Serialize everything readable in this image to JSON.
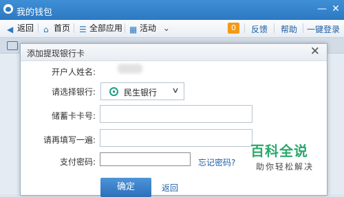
{
  "window": {
    "title": "我的钱包"
  },
  "toolbar": {
    "back": "返回",
    "home": "首页",
    "all_apps": "全部应用",
    "activity": "活动",
    "badge": "0",
    "feedback": "反馈",
    "help": "帮助",
    "login": "一键登录"
  },
  "dialog": {
    "title": "添加提现银行卡",
    "name_label": "开户人姓名:",
    "bank_label": "请选择银行:",
    "bank_selected": "民生银行",
    "card_label": "储蓄卡卡号:",
    "card_value": "",
    "card_confirm_label": "请再填写一遍:",
    "card_confirm_value": "",
    "pwd_label": "支付密码:",
    "pwd_value": "",
    "forgot": "忘记密码?",
    "ok": "确定",
    "back": "返回"
  },
  "watermark": {
    "brand": "百科全说",
    "slogan": "助你轻松解决"
  },
  "colors": {
    "accent": "#2c79c2",
    "badge": "#f29b15",
    "link": "#1d5fa6",
    "bank": "#17a085"
  }
}
